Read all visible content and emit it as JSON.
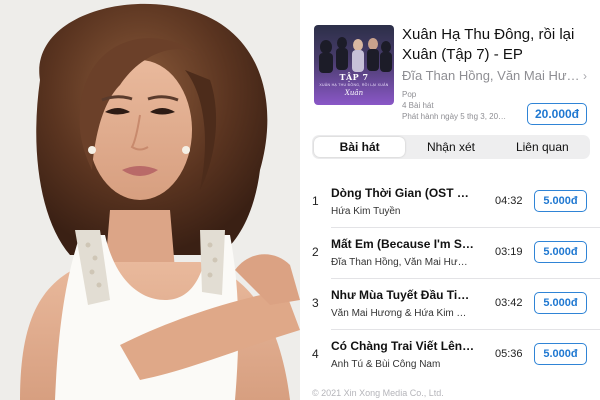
{
  "album": {
    "title": "Xuân Hạ Thu Đông, rồi lại Xuân (Tập 7) - EP",
    "artist": "Đĩa Than Hồng, Văn Mai Hương…",
    "genre": "Pop",
    "track_count": "4 Bài hát",
    "release": "Phát hành ngày 5 thg 3, 20…",
    "price": "20.000đ",
    "cover": {
      "tap_label": "TẬP 7",
      "sub_label": "XUÂN HẠ THU ĐÔNG, RỒI LẠI XUÂN",
      "signature": "Xuân",
      "accent": "#8a57c7"
    }
  },
  "tabs": [
    {
      "label": "Bài hát",
      "active": true
    },
    {
      "label": "Nhận xét",
      "active": false
    },
    {
      "label": "Liên quan",
      "active": false
    }
  ],
  "tracks": [
    {
      "number": "1",
      "title": "Dòng Thời Gian (OST Mù…",
      "artists": "Hứa Kim Tuyền",
      "duration": "04:32",
      "price": "5.000đ"
    },
    {
      "number": "2",
      "title": "Mất Em (Because I'm St…",
      "artists": "Đĩa Than Hồng, Văn Mai Hươ…",
      "duration": "03:19",
      "price": "5.000đ"
    },
    {
      "number": "3",
      "title": "Như Mùa Tuyết Đầu Tiên…",
      "artists": "Văn Mai Hương & Hứa Kim Tu…",
      "duration": "03:42",
      "price": "5.000đ"
    },
    {
      "number": "4",
      "title": "Có Chàng Trai Viết Lên C…",
      "artists": "Anh Tú & Bùi Công Nam",
      "duration": "05:36",
      "price": "5.000đ"
    }
  ],
  "footer": {
    "copyright": "© 2021 Xin Xong Media Co., Ltd."
  },
  "colors": {
    "accent_blue": "#2f84d6",
    "secondary_text": "#8e8e93"
  }
}
